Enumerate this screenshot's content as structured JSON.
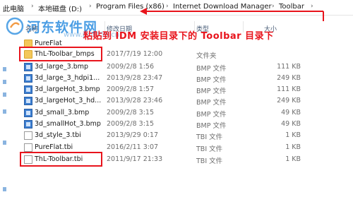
{
  "breadcrumb": {
    "items": [
      "此电脑",
      "本地磁盘 (D:)",
      "Program Files (x86)",
      "Internet Download Manager",
      "Toolbar"
    ]
  },
  "watermark": {
    "site_name": "河东软件网",
    "url": "www.pc0359.cn"
  },
  "annotation": {
    "text": "粘贴到 IDM 安装目录下的 Toolbar 目录下"
  },
  "columns": {
    "name": "名称",
    "date": "修改日期",
    "type": "类型",
    "size": "大小"
  },
  "files": [
    {
      "name": "PureFlat",
      "date": "",
      "type": "",
      "size": "",
      "kind": "folder"
    },
    {
      "name": "ThL-Toolbar_bmps",
      "date": "2017/7/19 12:00",
      "type": "文件夹",
      "size": "",
      "kind": "folder"
    },
    {
      "name": "3d_large_3.bmp",
      "date": "2009/2/8 1:56",
      "type": "BMP 文件",
      "size": "111 KB",
      "kind": "bmp"
    },
    {
      "name": "3d_large_3_hdpi1...",
      "date": "2013/9/28 23:47",
      "type": "BMP 文件",
      "size": "249 KB",
      "kind": "bmp"
    },
    {
      "name": "3d_largeHot_3.bmp",
      "date": "2009/2/8 1:57",
      "type": "BMP 文件",
      "size": "111 KB",
      "kind": "bmp"
    },
    {
      "name": "3d_largeHot_3_hd...",
      "date": "2013/9/28 23:46",
      "type": "BMP 文件",
      "size": "249 KB",
      "kind": "bmp"
    },
    {
      "name": "3d_small_3.bmp",
      "date": "2009/2/8 3:15",
      "type": "BMP 文件",
      "size": "49 KB",
      "kind": "bmp"
    },
    {
      "name": "3d_smallHot_3.bmp",
      "date": "2009/2/8 3:15",
      "type": "BMP 文件",
      "size": "49 KB",
      "kind": "bmp"
    },
    {
      "name": "3d_style_3.tbi",
      "date": "2013/9/29 0:17",
      "type": "TBI 文件",
      "size": "1 KB",
      "kind": "tbi"
    },
    {
      "name": "PureFlat.tbi",
      "date": "2016/2/11 3:07",
      "type": "TBI 文件",
      "size": "1 KB",
      "kind": "tbi"
    },
    {
      "name": "ThL-Toolbar.tbi",
      "date": "2011/9/17 21:33",
      "type": "TBI 文件",
      "size": "1 KB",
      "kind": "tbi"
    }
  ],
  "colors": {
    "annotation_red": "#e8141c",
    "folder_yellow": "#f3c75a",
    "bmp_blue": "#3d7fd1"
  }
}
